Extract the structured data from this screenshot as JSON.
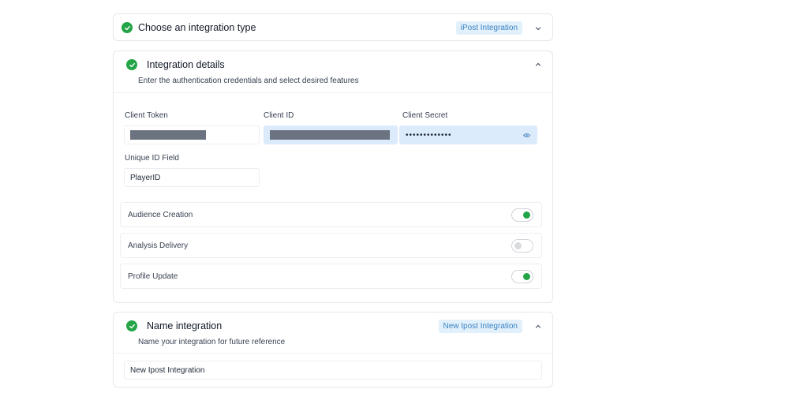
{
  "steps": {
    "type": {
      "title": "Choose an integration type",
      "badge": "iPost Integration"
    },
    "details": {
      "title": "Integration details",
      "subtitle": "Enter the authentication credentials and select desired features",
      "fields": {
        "client_token": {
          "label": "Client Token",
          "value": ""
        },
        "client_id": {
          "label": "Client ID",
          "value": ""
        },
        "client_secret": {
          "label": "Client Secret",
          "value": "•••••••••••••"
        },
        "unique_id": {
          "label": "Unique ID Field",
          "value": "PlayerID"
        }
      },
      "features": [
        {
          "label": "Audience Creation",
          "enabled": true
        },
        {
          "label": "Analysis Delivery",
          "enabled": false
        },
        {
          "label": "Profile Update",
          "enabled": true
        }
      ]
    },
    "name": {
      "title": "Name integration",
      "subtitle": "Name your integration for future reference",
      "badge": "New Ipost Integration",
      "value": "New Ipost Integration"
    }
  },
  "colors": {
    "success": "#22a447",
    "badge_text": "#3b82c4",
    "badge_bg": "#e1f0fa",
    "input_highlight": "#dcebfb"
  },
  "icons": {
    "step_status": "check-circle-icon",
    "collapse": "chevron-up-icon",
    "expand": "chevron-down-icon",
    "reveal": "eye-icon"
  }
}
